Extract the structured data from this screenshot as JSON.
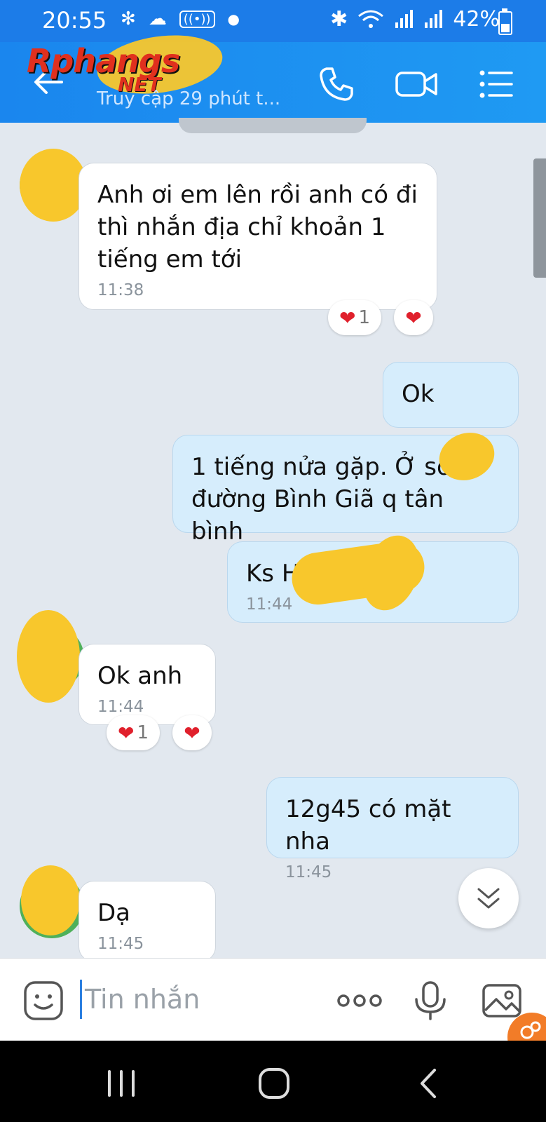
{
  "status": {
    "time": "20:55",
    "battery": "42%"
  },
  "header": {
    "logo_main": "Rphangs",
    "logo_sub": "NET",
    "subtitle": "Truy cập 29 phút t..."
  },
  "messages": [
    {
      "side": "in",
      "text": "Anh ơi em lên rồi anh có đi thì  nhắn địa chỉ khoản 1 tiếng em tới",
      "time": "11:38",
      "reactions": {
        "count": "1"
      }
    },
    {
      "side": "out",
      "text": "Ok"
    },
    {
      "side": "out",
      "text": "1 tiếng nửa gặp. Ở số đường Bình Giã q tân bình"
    },
    {
      "side": "out",
      "text": "Ks H... ...nha",
      "time": "11:44"
    },
    {
      "side": "in",
      "text": "Ok anh",
      "time": "11:44",
      "reactions": {
        "count": "1"
      }
    },
    {
      "side": "out",
      "text": "12g45 có mặt nha",
      "time": "11:45"
    },
    {
      "side": "in",
      "text": "Dạ",
      "time": "11:45"
    }
  ],
  "composer": {
    "placeholder": "Tin nhắn"
  },
  "colors": {
    "header": "#1a86ee",
    "incoming": "#ffffff",
    "outgoing": "#d6edfc",
    "heart": "#e0202c",
    "blur_blob": "#f8c72c"
  }
}
